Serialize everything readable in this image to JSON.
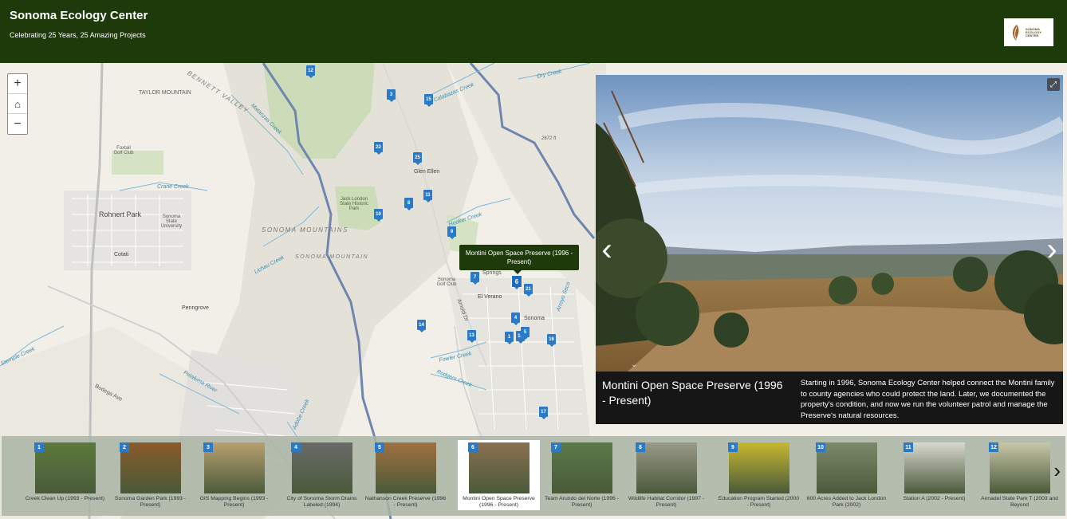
{
  "header": {
    "title": "Sonoma Ecology Center",
    "subtitle": "Celebrating 25 Years, 25 Amazing Projects",
    "logo_text": "SONOMA ECOLOGY CENTER"
  },
  "map": {
    "labels": {
      "taylor": "TAYLOR MOUNTAIN",
      "bennett": "BENNETT VALLEY",
      "matanzas": "Matanzas Creek",
      "calabazas": "Calabazas Creek",
      "dry": "Dry Creek",
      "foxtail": "Foxtail Golf Club",
      "crane": "Crane Creek",
      "rohnert": "Rohnert Park",
      "sonoma_state": "Sonoma State University",
      "cotati": "Cotati",
      "jack_london": "Jack London State Historic Park",
      "glen_ellen": "Glen Ellen",
      "elev": "2672 ft",
      "sonoma_mountains": "SONOMA MOUNTAINS",
      "sonoma_mountain": "SONOMA MOUNTAIN",
      "lichau": "Lichau Creek",
      "hooker": "Hooker Creek",
      "penngrove": "Penngrove",
      "springs": "Springs",
      "sonoma_golf": "Sonoma Golf Club",
      "el_verano": "El Verano",
      "arnold": "Arnold Dr",
      "arroyo": "Arroyo Seco",
      "sonoma": "Sonoma",
      "stemple": "Stemple Creek",
      "fowler": "Fowler Creek",
      "rodgers": "Rodgers Creek",
      "petaluma": "Petaluma River",
      "bodega": "Bodega Ave",
      "adobe": "Adobe Creek"
    },
    "zoom_in": "+",
    "home": "⌂",
    "zoom_out": "−",
    "markers": [
      "12",
      "3",
      "15",
      "22",
      "25",
      "11",
      "8",
      "10",
      "9",
      "7",
      "6",
      "21",
      "4",
      "14",
      "13",
      "1",
      "18",
      "5",
      "16",
      "17"
    ],
    "tooltip": "Montini Open Space Preserve (1996 - Present)"
  },
  "media": {
    "expand_icon": "⤢",
    "prev": "‹",
    "next": "›",
    "toggle": "⌄",
    "caption_title": "Montini Open Space Preserve (1996 - Present)",
    "caption_desc": "Starting in 1996, Sonoma Ecology Center helped connect the Montini family to county agencies who could protect the land. Later, we documented the property's condition, and now we run the volunteer patrol and manage the Preserve's natural resources."
  },
  "carousel": {
    "items": [
      {
        "num": "1",
        "label": "Creek Clean Up (1993 - Present)",
        "color": "#5c7a3c"
      },
      {
        "num": "2",
        "label": "Sonoma Garden Park (1993 - Present)",
        "color": "#8a5a2a"
      },
      {
        "num": "3",
        "label": "GIS Mapping Begins (1993 - Present)",
        "color": "#b8a070"
      },
      {
        "num": "4",
        "label": "City of Sonoma Storm Drains Labeled (1994)",
        "color": "#6a6a6a"
      },
      {
        "num": "5",
        "label": "Nathanson Creek Preserve (1996 - Present)",
        "color": "#a07040"
      },
      {
        "num": "6",
        "label": "Montini Open Space Preserve (1996 - Present)",
        "color": "#8a7050"
      },
      {
        "num": "7",
        "label": "Team Arundo del Norte (1996 - Present)",
        "color": "#5a7a4a"
      },
      {
        "num": "8",
        "label": "Wildlife Habitat Corridor (1997 - Present)",
        "color": "#9a9a8a"
      },
      {
        "num": "9",
        "label": "Education Program Started (2000 - Present)",
        "color": "#c8b830"
      },
      {
        "num": "10",
        "label": "600 Acres Added to Jack London Park (2002)",
        "color": "#7a8a6a"
      },
      {
        "num": "11",
        "label": "Station A (2002 - Present)",
        "color": "#d8d8d0"
      },
      {
        "num": "12",
        "label": "Annadel State Park T (2003 and Beyond",
        "color": "#c8c8a8"
      }
    ],
    "next": "›"
  }
}
